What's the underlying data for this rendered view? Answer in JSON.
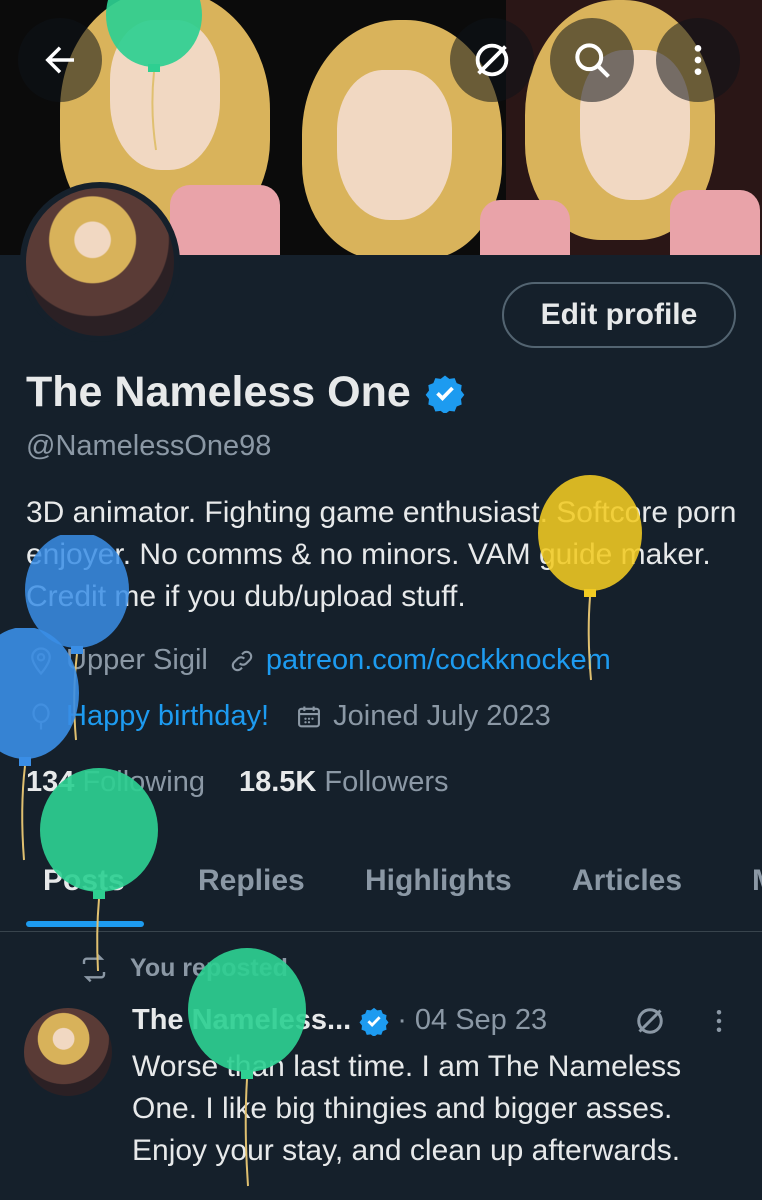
{
  "profile": {
    "name": "The Nameless One",
    "handle": "@NamelessOne98",
    "bio": "3D animator. Fighting game enthusiast. Softcore porn enjoyer. No comms & no minors. VAM guide maker. Credit me if you dub/upload stuff.",
    "location": "Upper Sigil",
    "website": "patreon.com/cockknockem",
    "birthday": "Happy birthday!",
    "joined": "Joined July 2023",
    "following_count": "134",
    "following_label": "Following",
    "followers_count": "18.5K",
    "followers_label": "Followers",
    "edit_button": "Edit profile"
  },
  "tabs": [
    {
      "label": "Posts"
    },
    {
      "label": "Replies"
    },
    {
      "label": "Highlights"
    },
    {
      "label": "Articles"
    }
  ],
  "post": {
    "repost_label": "You reposted",
    "author": "The Nameless...",
    "separator": "·",
    "date": "04 Sep 23",
    "text": "Worse than last time. I am The Nameless One. I like big thingies and bigger asses. Enjoy your stay, and clean up afterwards."
  },
  "icons": {
    "back": "arrow-left-icon",
    "grok": "grok-icon",
    "search": "search-icon",
    "more": "more-vertical-icon",
    "verified": "verified-badge-icon",
    "location": "location-pin-icon",
    "link": "link-icon",
    "balloon": "balloon-icon",
    "calendar": "calendar-icon",
    "retweet": "repost-icon"
  },
  "colors": {
    "background": "#15202b",
    "accent": "#1d9bf0",
    "secondary_text": "#8b98a5"
  }
}
